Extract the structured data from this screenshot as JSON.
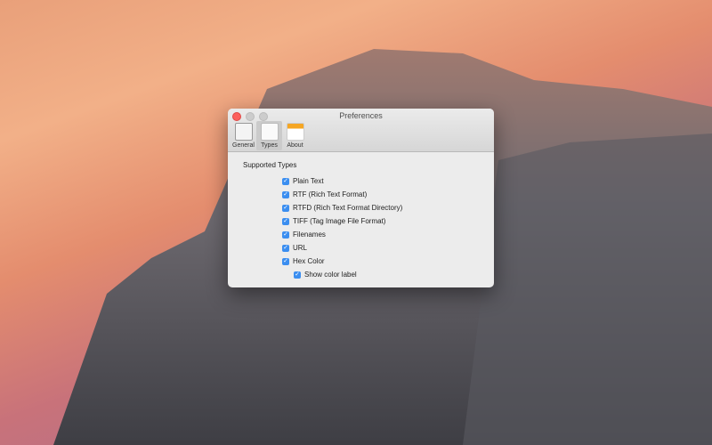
{
  "window": {
    "title": "Preferences"
  },
  "toolbar": {
    "tabs": [
      {
        "label": "General",
        "icon": "switch-icon"
      },
      {
        "label": "Types",
        "icon": "document-icon",
        "active": true
      },
      {
        "label": "About",
        "icon": "notes-icon"
      }
    ]
  },
  "types": {
    "heading": "Supported Types",
    "items": [
      {
        "label": "Plain Text",
        "checked": true
      },
      {
        "label": "RTF (Rich Text Format)",
        "checked": true
      },
      {
        "label": "RTFD (Rich Text Format Directory)",
        "checked": true
      },
      {
        "label": "TIFF (Tag Image File Format)",
        "checked": true
      },
      {
        "label": "Filenames",
        "checked": true
      },
      {
        "label": "URL",
        "checked": true
      },
      {
        "label": "Hex Color",
        "checked": true
      }
    ],
    "sub_option": {
      "label": "Show color label",
      "checked": true
    }
  }
}
